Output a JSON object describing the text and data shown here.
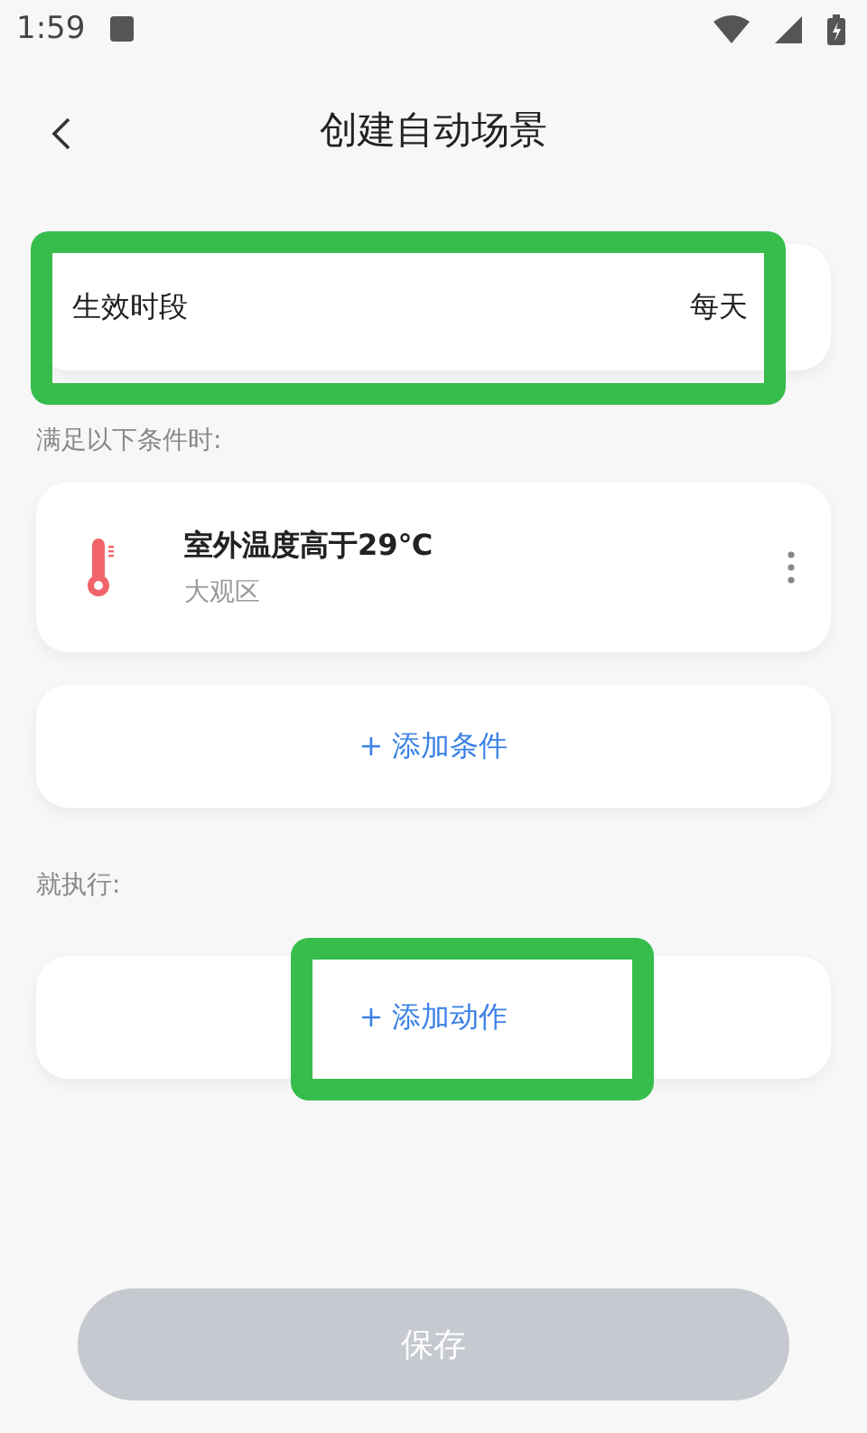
{
  "status_bar": {
    "time": "1:59"
  },
  "header": {
    "title": "创建自动场景"
  },
  "schedule": {
    "label": "生效时段",
    "value": "每天",
    "highlighted": true
  },
  "conditions_label": "满足以下条件时:",
  "conditions": [
    {
      "title": "室外温度高于29℃",
      "subtitle": "大观区"
    }
  ],
  "add_condition": {
    "label": "+ 添加条件",
    "highlighted": false
  },
  "actions_label": "就执行:",
  "add_action": {
    "label": "+ 添加动作",
    "highlighted": true
  },
  "save_button": {
    "label": "保存",
    "disabled": true
  }
}
